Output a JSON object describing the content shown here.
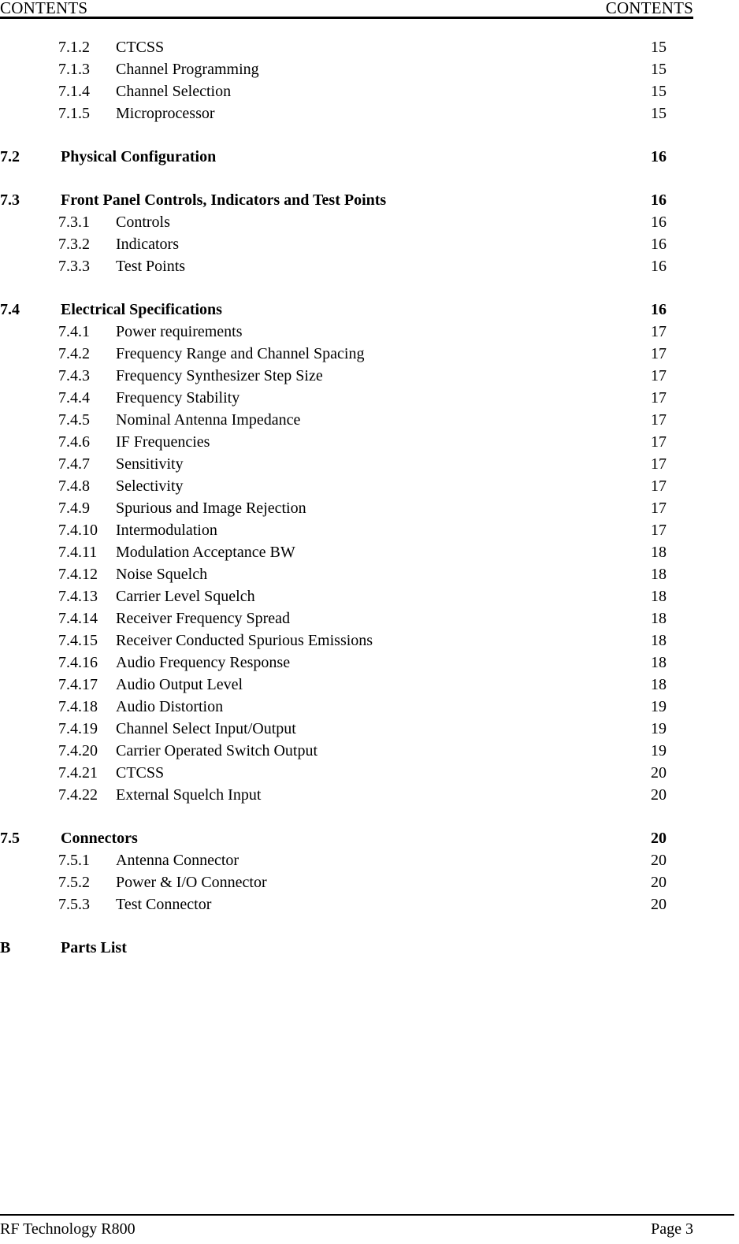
{
  "header": {
    "left": "CONTENTS",
    "right": "CONTENTS"
  },
  "footer": {
    "left": "RF Technology  R800",
    "right": "Page 3"
  },
  "toc": {
    "rows": [
      {
        "level": 2,
        "number": "7.1.2",
        "title": "CTCSS",
        "page": "15",
        "gap_before": false
      },
      {
        "level": 2,
        "number": "7.1.3",
        "title": "Channel Programming",
        "page": "15",
        "gap_before": false
      },
      {
        "level": 2,
        "number": "7.1.4",
        "title": "Channel Selection",
        "page": "15",
        "gap_before": false
      },
      {
        "level": 2,
        "number": "7.1.5",
        "title": "Microprocessor",
        "page": "15",
        "gap_before": false
      },
      {
        "level": 1,
        "number": "7.2",
        "title": "Physical Configuration",
        "page": "16",
        "gap_before": true
      },
      {
        "level": 1,
        "number": "7.3",
        "title": "Front Panel Controls, Indicators and Test Points",
        "page": "16",
        "gap_before": true
      },
      {
        "level": 2,
        "number": "7.3.1",
        "title": "Controls",
        "page": "16",
        "gap_before": false
      },
      {
        "level": 2,
        "number": "7.3.2",
        "title": "Indicators",
        "page": "16",
        "gap_before": false
      },
      {
        "level": 2,
        "number": "7.3.3",
        "title": "Test Points",
        "page": "16",
        "gap_before": false
      },
      {
        "level": 1,
        "number": "7.4",
        "title": "Electrical Specifications",
        "page": "16",
        "gap_before": true
      },
      {
        "level": 2,
        "number": "7.4.1",
        "title": "Power requirements",
        "page": "17",
        "gap_before": false
      },
      {
        "level": 2,
        "number": "7.4.2",
        "title": "Frequency Range and Channel Spacing",
        "page": "17",
        "gap_before": false
      },
      {
        "level": 2,
        "number": "7.4.3",
        "title": "Frequency Synthesizer Step Size",
        "page": "17",
        "gap_before": false
      },
      {
        "level": 2,
        "number": "7.4.4",
        "title": "Frequency Stability",
        "page": "17",
        "gap_before": false
      },
      {
        "level": 2,
        "number": "7.4.5",
        "title": "Nominal Antenna Impedance",
        "page": "17",
        "gap_before": false
      },
      {
        "level": 2,
        "number": "7.4.6",
        "title": "IF Frequencies",
        "page": "17",
        "gap_before": false
      },
      {
        "level": 2,
        "number": "7.4.7",
        "title": "Sensitivity",
        "page": "17",
        "gap_before": false
      },
      {
        "level": 2,
        "number": "7.4.8",
        "title": "Selectivity",
        "page": "17",
        "gap_before": false
      },
      {
        "level": 2,
        "number": "7.4.9",
        "title": "Spurious and Image Rejection",
        "page": "17",
        "gap_before": false
      },
      {
        "level": 2,
        "number": "7.4.10",
        "title": "Intermodulation",
        "page": "17",
        "gap_before": false
      },
      {
        "level": 2,
        "number": "7.4.11",
        "title": "Modulation Acceptance BW",
        "page": "18",
        "gap_before": false
      },
      {
        "level": 2,
        "number": "7.4.12",
        "title": "Noise Squelch",
        "page": "18",
        "gap_before": false
      },
      {
        "level": 2,
        "number": "7.4.13",
        "title": "Carrier Level Squelch",
        "page": "18",
        "gap_before": false
      },
      {
        "level": 2,
        "number": "7.4.14",
        "title": "Receiver Frequency Spread",
        "page": "18",
        "gap_before": false
      },
      {
        "level": 2,
        "number": "7.4.15",
        "title": "Receiver Conducted Spurious Emissions",
        "page": "18",
        "gap_before": false
      },
      {
        "level": 2,
        "number": "7.4.16",
        "title": "Audio Frequency Response",
        "page": "18",
        "gap_before": false
      },
      {
        "level": 2,
        "number": "7.4.17",
        "title": "Audio Output Level",
        "page": "18",
        "gap_before": false
      },
      {
        "level": 2,
        "number": "7.4.18",
        "title": "Audio Distortion",
        "page": "19",
        "gap_before": false
      },
      {
        "level": 2,
        "number": "7.4.19",
        "title": "Channel Select Input/Output",
        "page": "19",
        "gap_before": false
      },
      {
        "level": 2,
        "number": "7.4.20",
        "title": "Carrier Operated Switch Output",
        "page": "19",
        "gap_before": false
      },
      {
        "level": 2,
        "number": "7.4.21",
        "title": "CTCSS",
        "page": "20",
        "gap_before": false
      },
      {
        "level": 2,
        "number": "7.4.22",
        "title": "External Squelch Input",
        "page": "20",
        "gap_before": false
      },
      {
        "level": 1,
        "number": "7.5",
        "title": "Connectors",
        "page": "20",
        "gap_before": true
      },
      {
        "level": 2,
        "number": "7.5.1",
        "title": "Antenna Connector",
        "page": "20",
        "gap_before": false
      },
      {
        "level": 2,
        "number": "7.5.2",
        "title": "Power & I/O Connector",
        "page": "20",
        "gap_before": false
      },
      {
        "level": 2,
        "number": "7.5.3",
        "title": "Test Connector",
        "page": "20",
        "gap_before": false
      },
      {
        "level": 1,
        "number": "B",
        "title": "Parts List",
        "page": "",
        "gap_before": true
      }
    ]
  }
}
